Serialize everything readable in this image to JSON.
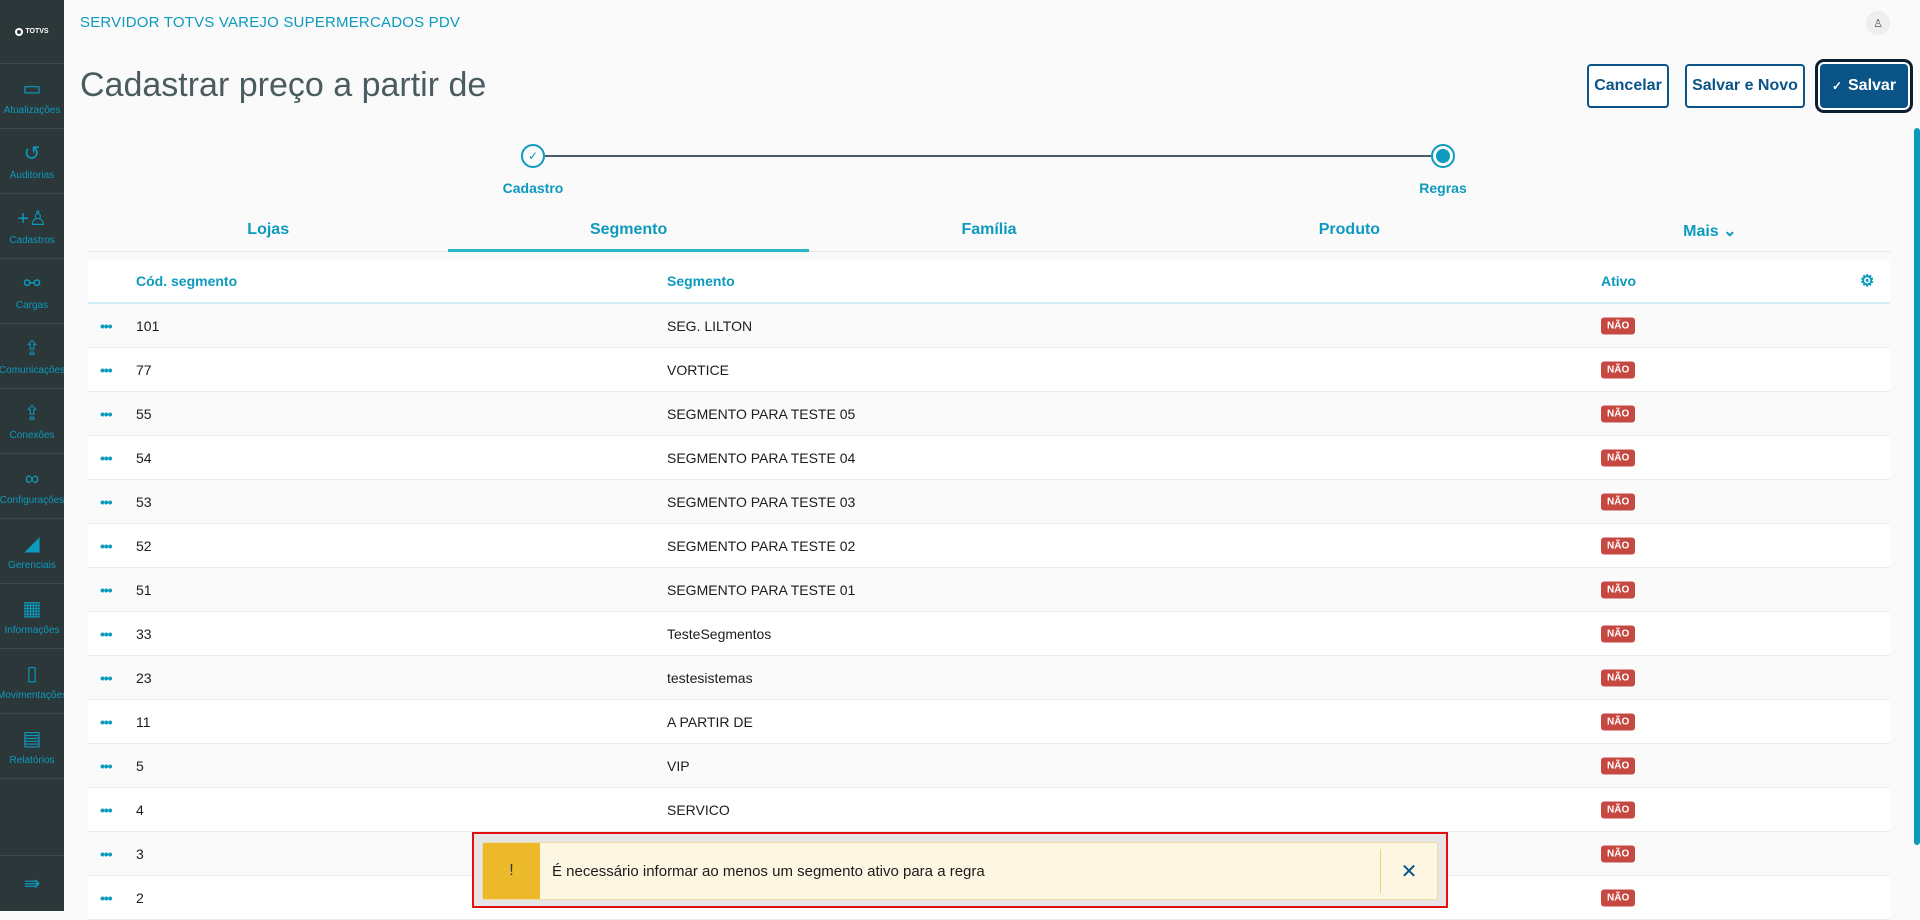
{
  "app": {
    "brand": "TOTVS",
    "title": "SERVIDOR TOTVS VAREJO SUPERMERCADOS PDV"
  },
  "sidebar": {
    "items": [
      {
        "label": "Atualizações",
        "icon": "server-icon",
        "glyph": "▭"
      },
      {
        "label": "Auditorias",
        "icon": "history-icon",
        "glyph": "↺"
      },
      {
        "label": "Cadastros",
        "icon": "add-user-icon",
        "glyph": "+♙"
      },
      {
        "label": "Cargas",
        "icon": "share-icon",
        "glyph": "⚯"
      },
      {
        "label": "Comunicações",
        "icon": "upload-file-icon",
        "glyph": "⇪"
      },
      {
        "label": "Conexões",
        "icon": "upload-file-icon",
        "glyph": "⇪"
      },
      {
        "label": "Configurações",
        "icon": "link-icon",
        "glyph": "∞"
      },
      {
        "label": "Gerenciais",
        "icon": "chart-icon",
        "glyph": "◢"
      },
      {
        "label": "Informações",
        "icon": "building-icon",
        "glyph": "▦"
      },
      {
        "label": "Movimentações",
        "icon": "book-icon",
        "glyph": "▯"
      },
      {
        "label": "Relatórios",
        "icon": "document-icon",
        "glyph": "▤"
      }
    ],
    "collapse_glyph": "⇛"
  },
  "page": {
    "title": "Cadastrar preço a partir de"
  },
  "actions": {
    "cancel": "Cancelar",
    "save_new": "Salvar e Novo",
    "save": "Salvar",
    "save_icon": "✓"
  },
  "stepper": {
    "steps": [
      {
        "label": "Cadastro",
        "state": "done"
      },
      {
        "label": "Regras",
        "state": "current"
      }
    ]
  },
  "tabs": [
    {
      "label": "Lojas"
    },
    {
      "label": "Segmento",
      "active": true
    },
    {
      "label": "Família"
    },
    {
      "label": "Produto"
    },
    {
      "label": "Mais ⌄"
    }
  ],
  "table": {
    "columns": [
      "Cód. segmento",
      "Segmento",
      "Ativo"
    ],
    "rows": [
      {
        "cod": "101",
        "segmento": "SEG. LILTON",
        "ativo": "NÃO"
      },
      {
        "cod": "77",
        "segmento": "VORTICE",
        "ativo": "NÃO"
      },
      {
        "cod": "55",
        "segmento": "SEGMENTO PARA TESTE 05",
        "ativo": "NÃO"
      },
      {
        "cod": "54",
        "segmento": "SEGMENTO PARA TESTE 04",
        "ativo": "NÃO"
      },
      {
        "cod": "53",
        "segmento": "SEGMENTO PARA TESTE 03",
        "ativo": "NÃO"
      },
      {
        "cod": "52",
        "segmento": "SEGMENTO PARA TESTE 02",
        "ativo": "NÃO"
      },
      {
        "cod": "51",
        "segmento": "SEGMENTO PARA TESTE 01",
        "ativo": "NÃO"
      },
      {
        "cod": "33",
        "segmento": "TesteSegmentos",
        "ativo": "NÃO"
      },
      {
        "cod": "23",
        "segmento": "testesistemas",
        "ativo": "NÃO"
      },
      {
        "cod": "11",
        "segmento": "A PARTIR DE",
        "ativo": "NÃO"
      },
      {
        "cod": "5",
        "segmento": "VIP",
        "ativo": "NÃO"
      },
      {
        "cod": "4",
        "segmento": "SERVICO",
        "ativo": "NÃO"
      },
      {
        "cod": "3",
        "segmento": "",
        "ativo": "NÃO"
      },
      {
        "cod": "2",
        "segmento": "",
        "ativo": "NÃO"
      }
    ]
  },
  "toast": {
    "icon": "!",
    "message": "É necessário informar ao menos um segmento ativo para a regra",
    "close": "✕"
  },
  "colors": {
    "accent": "#0c9abe",
    "primary": "#0b5488",
    "danger": "#c64840",
    "warning": "#ecb92b"
  }
}
